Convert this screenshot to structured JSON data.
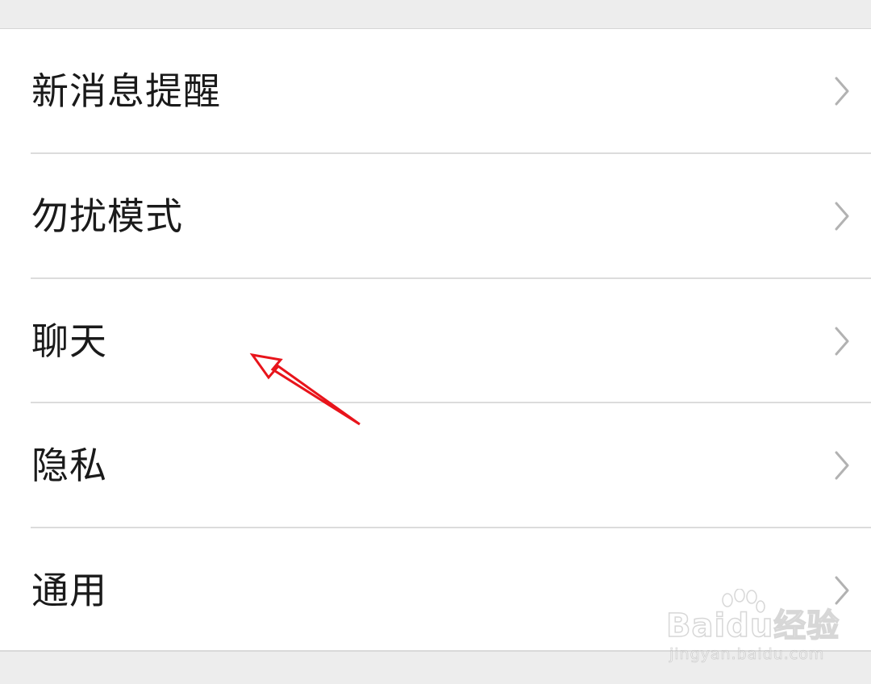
{
  "menu": {
    "items": [
      {
        "label": "新消息提醒",
        "icon": "chevron-right-icon"
      },
      {
        "label": "勿扰模式",
        "icon": "chevron-right-icon"
      },
      {
        "label": "聊天",
        "icon": "chevron-right-icon"
      },
      {
        "label": "隐私",
        "icon": "chevron-right-icon"
      },
      {
        "label": "通用",
        "icon": "chevron-right-icon"
      }
    ]
  },
  "annotation": {
    "arrow_color": "#e8141b",
    "icon": "red-arrow-annotation"
  },
  "watermark": {
    "brand": "Baidu经验",
    "url": "jingyan.baidu.com"
  },
  "colors": {
    "background": "#ededed",
    "card": "#ffffff",
    "text": "#1a1a1a",
    "divider": "#dcdcdc",
    "chevron": "#b2b2b2"
  }
}
